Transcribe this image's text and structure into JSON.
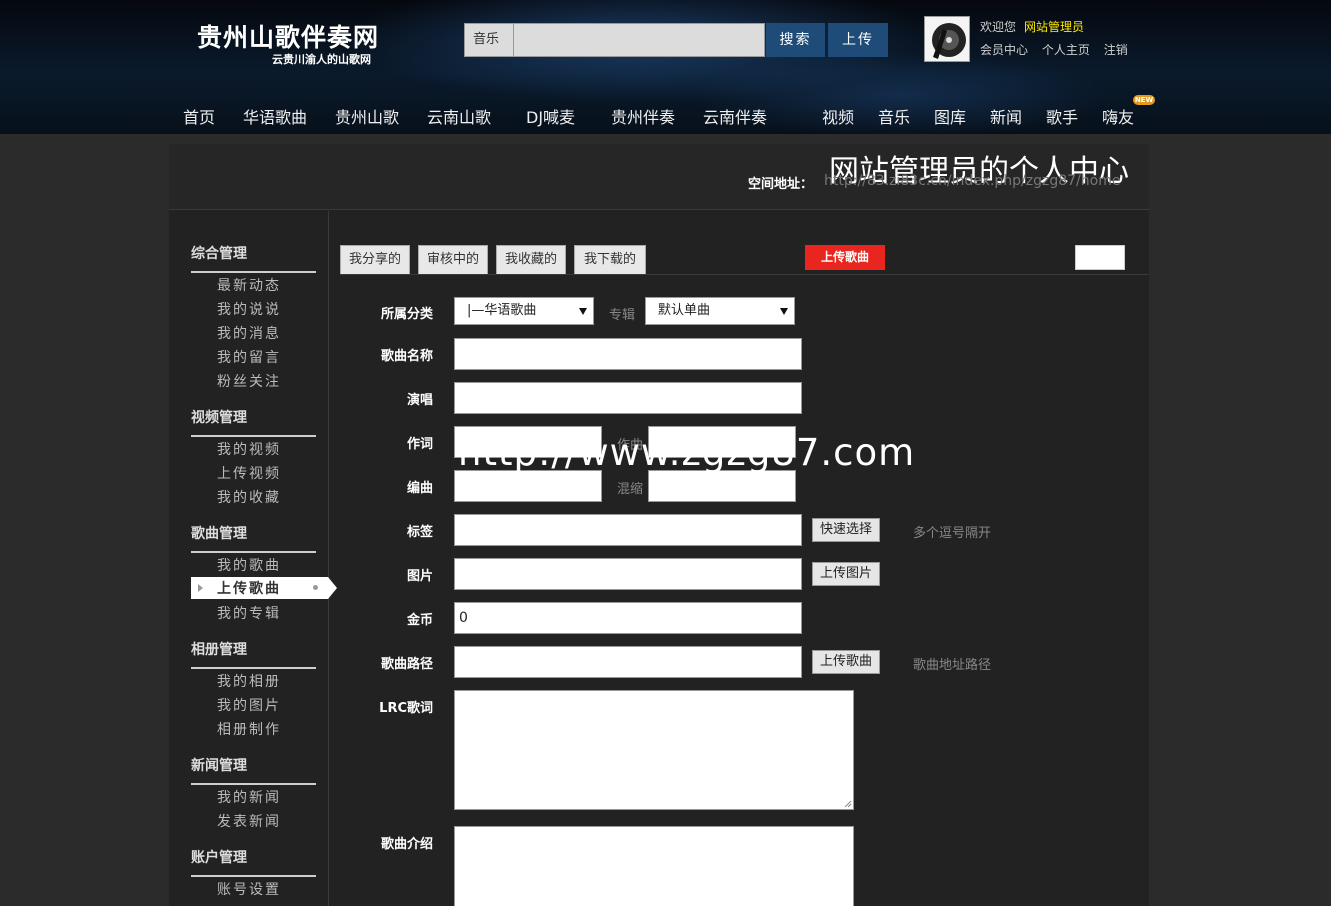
{
  "header": {
    "site_title": "贵州山歌伴奏网",
    "site_subtitle": "云贵川渝人的山歌网",
    "search_category": "音乐",
    "search_placeholder": "",
    "search_button": "搜索",
    "upload_button": "上传",
    "welcome_text": "欢迎您",
    "username": "网站管理员",
    "user_links": [
      "会员中心",
      "个人主页",
      "注销"
    ],
    "nav": [
      "首页",
      "华语歌曲",
      "贵州山歌",
      "云南山歌",
      "DJ喊麦",
      "贵州伴奏",
      "云南伴奏",
      "视频",
      "音乐",
      "图库",
      "新闻",
      "歌手",
      "嗨友"
    ],
    "new_badge": "NEW"
  },
  "page": {
    "center_title": "网站管理员的个人中心",
    "space_address_label": "空间地址：",
    "space_address_url": "http://83.zi83c.cn/index.php/zgzg87/home"
  },
  "sidebar": {
    "groups": [
      {
        "title": "综合管理",
        "items": [
          "最新动态",
          "我的说说",
          "我的消息",
          "我的留言",
          "粉丝关注"
        ]
      },
      {
        "title": "视频管理",
        "items": [
          "我的视频",
          "上传视频",
          "我的收藏"
        ]
      },
      {
        "title": "歌曲管理",
        "items": [
          "我的歌曲",
          "上传歌曲",
          "我的专辑"
        ]
      },
      {
        "title": "相册管理",
        "items": [
          "我的相册",
          "我的图片",
          "相册制作"
        ]
      },
      {
        "title": "新闻管理",
        "items": [
          "我的新闻",
          "发表新闻"
        ]
      },
      {
        "title": "账户管理",
        "items": [
          "账号设置"
        ]
      }
    ],
    "active_item": "上传歌曲"
  },
  "tabs": [
    "我分享的",
    "审核中的",
    "我收藏的",
    "我下载的"
  ],
  "upload_song_tab": "上传歌曲",
  "form": {
    "category_label": "所属分类",
    "category_value": "|—华语歌曲",
    "album_label": "专辑",
    "album_value": "默认单曲",
    "song_name_label": "歌曲名称",
    "singer_label": "演唱",
    "lyricist_label": "作词",
    "composer_label": "作曲",
    "arranger_label": "编曲",
    "mixer_label": "混缩",
    "tags_label": "标签",
    "quick_select_button": "快速选择",
    "tags_hint": "多个逗号隔开",
    "image_label": "图片",
    "upload_image_button": "上传图片",
    "coins_label": "金币",
    "coins_value": "0",
    "path_label": "歌曲路径",
    "upload_song_button": "上传歌曲",
    "path_hint": "歌曲地址路径",
    "lrc_label": "LRC歌词",
    "intro_label": "歌曲介绍"
  },
  "watermark": "http://www.zgzg87.com"
}
